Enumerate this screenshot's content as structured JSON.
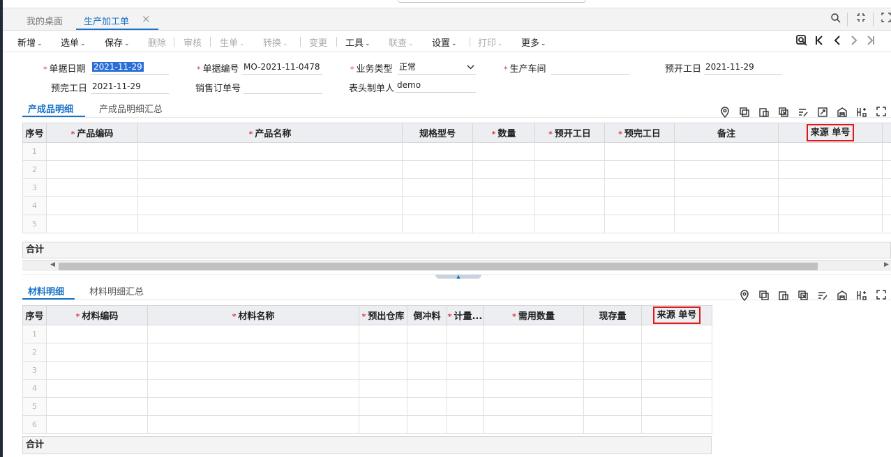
{
  "tabs": [
    {
      "label": "我的桌面",
      "active": false
    },
    {
      "label": "生产加工单",
      "active": true
    }
  ],
  "tab_close": "×",
  "tab_icons": [
    "search-icon",
    "collapse-icon",
    "expand-icon"
  ],
  "toolbar": {
    "items": [
      {
        "label": "新增",
        "caret": true,
        "enabled": true
      },
      {
        "label": "选单",
        "caret": true,
        "enabled": true
      },
      {
        "label": "保存",
        "caret": true,
        "enabled": true
      },
      {
        "label": "删除",
        "caret": false,
        "enabled": false
      },
      {
        "label": "审核",
        "caret": false,
        "enabled": false
      },
      {
        "label": "生单",
        "caret": true,
        "enabled": false
      },
      {
        "label": "转换",
        "caret": true,
        "enabled": false
      },
      {
        "label": "变更",
        "caret": false,
        "enabled": false
      },
      {
        "label": "工具",
        "caret": true,
        "enabled": true
      },
      {
        "label": "联查",
        "caret": true,
        "enabled": false
      },
      {
        "label": "设置",
        "caret": true,
        "enabled": true
      },
      {
        "label": "打印",
        "caret": true,
        "enabled": false
      },
      {
        "label": "更多",
        "caret": true,
        "enabled": true
      }
    ],
    "caret_glyph": "❯",
    "nav_icons": [
      "find-icon",
      "first-icon",
      "prev-icon",
      "next-icon",
      "last-icon"
    ]
  },
  "form": {
    "doc_date": {
      "label": "单据日期",
      "value": "2021-11-29",
      "required": true
    },
    "doc_no": {
      "label": "单据编号",
      "value": "MO-2021-11-0478",
      "required": true
    },
    "biz_type": {
      "label": "业务类型",
      "value": "正常",
      "required": true
    },
    "workshop": {
      "label": "生产车间",
      "value": "",
      "required": true
    },
    "plan_start": {
      "label": "预开工日",
      "value": "2021-11-29"
    },
    "plan_finish": {
      "label": "预完工日",
      "value": "2021-11-29"
    },
    "sales_order": {
      "label": "销售订单号",
      "value": ""
    },
    "maker": {
      "label": "表头制单人",
      "value": "demo"
    }
  },
  "products": {
    "tabs": [
      "产成品明细",
      "产成品明细汇总"
    ],
    "icons": [
      "location-icon",
      "copy-row-icon",
      "paste-icon",
      "delete-row-icon",
      "batch-edit-icon",
      "export-icon",
      "warehouse-icon",
      "insert-column-icon",
      "fullscreen-icon"
    ],
    "columns": [
      {
        "label": "序号",
        "required": false
      },
      {
        "label": "产品编码",
        "required": true
      },
      {
        "label": "产品名称",
        "required": true
      },
      {
        "label": "规格型号",
        "required": false
      },
      {
        "label": "数量",
        "required": true
      },
      {
        "label": "预开工日",
        "required": true
      },
      {
        "label": "预完工日",
        "required": true
      },
      {
        "label": "备注",
        "required": false
      },
      {
        "label": "来源 单号",
        "required": false,
        "highlight": true
      }
    ],
    "rows": [
      "1",
      "2",
      "3",
      "4",
      "5"
    ],
    "total_label": "合计"
  },
  "materials": {
    "tabs": [
      "材料明细",
      "材料明细汇总"
    ],
    "icons": [
      "location-icon",
      "copy-row-icon",
      "paste-icon",
      "delete-row-icon",
      "batch-edit-icon",
      "warehouse-icon",
      "insert-column-icon",
      "fullscreen-icon"
    ],
    "columns": [
      {
        "label": "序号",
        "required": false
      },
      {
        "label": "材料编码",
        "required": true
      },
      {
        "label": "材料名称",
        "required": true
      },
      {
        "label": "预出仓库",
        "required": true
      },
      {
        "label": "倒冲料",
        "required": false
      },
      {
        "label": "计量...",
        "required": true
      },
      {
        "label": "需用数量",
        "required": true
      },
      {
        "label": "现存量",
        "required": false
      },
      {
        "label": "来源 单号",
        "required": false,
        "highlight": true
      }
    ],
    "rows": [
      "1",
      "2",
      "3",
      "4",
      "5",
      "6"
    ],
    "total_label": "合计"
  },
  "colors": {
    "accent": "#1a73c8",
    "highlight_border": "#e01818",
    "required": "#e03b3b",
    "selection": "#2b6fd6"
  }
}
